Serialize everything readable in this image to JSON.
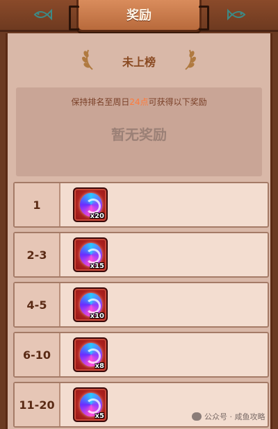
{
  "header": {
    "title": "奖励",
    "left_icon": "fish-icon",
    "right_icon": "fish-icon"
  },
  "status": {
    "label": "未上榜",
    "decoration_icon": "laurel-icon"
  },
  "info": {
    "prefix": "保持排名至周日",
    "highlight": "24点",
    "suffix": "可获得以下奖励",
    "empty_text": "暂无奖励"
  },
  "rewards": [
    {
      "rank": "1",
      "item_icon": "swirl-orb-icon",
      "qty": "x20"
    },
    {
      "rank": "2-3",
      "item_icon": "swirl-orb-icon",
      "qty": "x15"
    },
    {
      "rank": "4-5",
      "item_icon": "swirl-orb-icon",
      "qty": "x10"
    },
    {
      "rank": "6-10",
      "item_icon": "swirl-orb-icon",
      "qty": "x8"
    },
    {
      "rank": "11-20",
      "item_icon": "swirl-orb-icon",
      "qty": "x5"
    }
  ],
  "watermark": {
    "text": "公众号 · 咸鱼攻略"
  },
  "colors": {
    "wood": "#6e3a20",
    "panel": "#d9b8a8",
    "highlight": "#ff7a3a",
    "title_plate": "#d98c5c"
  }
}
